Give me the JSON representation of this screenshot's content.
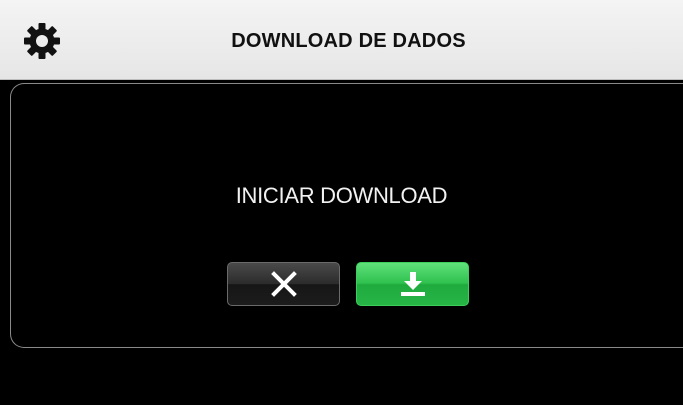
{
  "header": {
    "title": "DOWNLOAD DE DADOS",
    "settings_icon": "gear-icon"
  },
  "dialog": {
    "message": "INICIAR DOWNLOAD",
    "cancel_icon": "close-icon",
    "confirm_icon": "download-icon"
  },
  "colors": {
    "header_bg": "#ececec",
    "screen_bg": "#000000",
    "confirm_green": "#2fc14f",
    "cancel_dark": "#2b2b2b"
  }
}
